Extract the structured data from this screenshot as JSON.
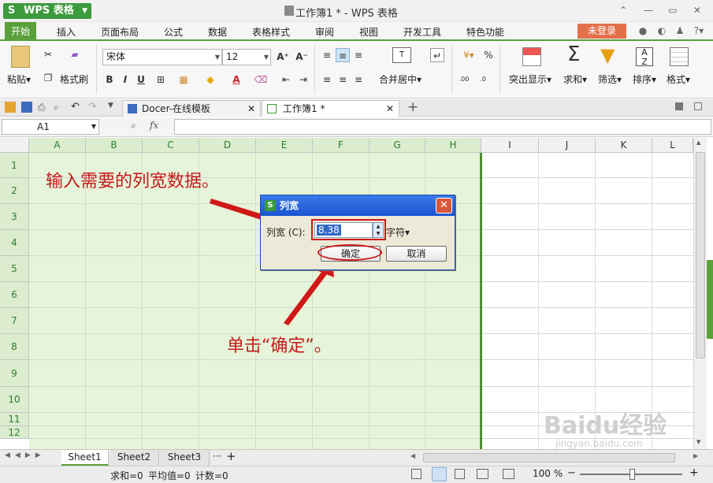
{
  "titlebar": {
    "app_logo": "S",
    "app_name": "WPS 表格",
    "window_title": "工作簿1 * - WPS 表格"
  },
  "menubar": {
    "tabs": [
      "开始",
      "插入",
      "页面布局",
      "公式",
      "数据",
      "表格样式",
      "审阅",
      "视图",
      "开发工具",
      "特色功能"
    ],
    "login": "未登录"
  },
  "ribbon": {
    "paste": "粘贴",
    "format_painter": "格式刷",
    "font_name": "宋体",
    "font_size": "12",
    "merge_center": "合并居中",
    "highlight": "突出显示",
    "sum": "求和",
    "filter": "筛选",
    "sort": "排序",
    "format": "格式",
    "percent": "%"
  },
  "doctabs": {
    "tab1": "Docer-在线模板",
    "tab2": "工作簿1 *"
  },
  "formula": {
    "namebox": "A1",
    "fx": "fx"
  },
  "grid": {
    "columns": [
      "A",
      "B",
      "C",
      "D",
      "E",
      "F",
      "G",
      "H",
      "I",
      "J",
      "K",
      "L"
    ],
    "rows": [
      "1",
      "2",
      "3",
      "4",
      "5",
      "6",
      "7",
      "8",
      "9",
      "10",
      "11",
      "12"
    ]
  },
  "annotations": {
    "top": "输入需要的列宽数据。",
    "bottom": "单击“确定”。"
  },
  "dialog": {
    "logo": "S",
    "title": "列宽",
    "label": "列宽 (C):",
    "value": "8.38",
    "unit": "字符",
    "ok": "确定",
    "cancel": "取消"
  },
  "sheets": {
    "tabs": [
      "Sheet1",
      "Sheet2",
      "Sheet3"
    ],
    "more": "···",
    "add": "+"
  },
  "status": {
    "sum": "求和=0",
    "avg": "平均值=0",
    "count": "计数=0",
    "zoom": "100 %"
  },
  "watermark": {
    "brand": "Baidu经验",
    "url": "jingyan.baidu.com"
  }
}
